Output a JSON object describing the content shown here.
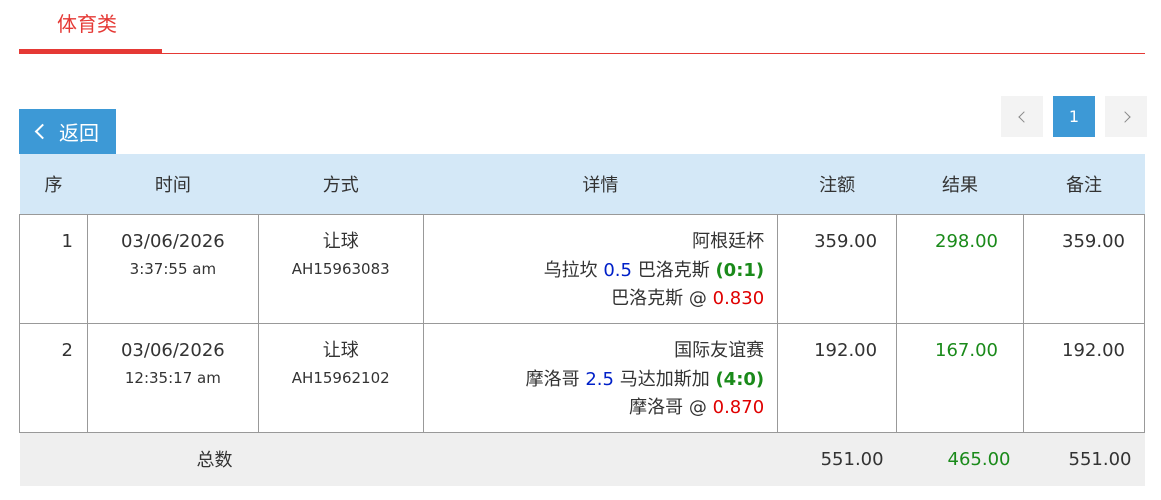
{
  "tabs": {
    "active_label": "体育类"
  },
  "back_button": {
    "label": "返回"
  },
  "pagination": {
    "current_page": "1"
  },
  "table": {
    "headers": {
      "no": "序",
      "time": "时间",
      "method": "方式",
      "detail": "详情",
      "stake": "注额",
      "result": "结果",
      "note": "备注"
    },
    "rows": [
      {
        "no": "1",
        "date": "03/06/2026",
        "time": "3:37:55 am",
        "method": "让球",
        "code": "AH15963083",
        "league": "阿根廷杯",
        "home": "乌拉坎",
        "handicap": "0.5",
        "away": "巴洛克斯",
        "score": "(0:1)",
        "pick": "巴洛克斯",
        "at": "@",
        "odds": "0.830",
        "stake": "359.00",
        "result": "298.00",
        "note": "359.00"
      },
      {
        "no": "2",
        "date": "03/06/2026",
        "time": "12:35:17 am",
        "method": "让球",
        "code": "AH15962102",
        "league": "国际友谊赛",
        "home": "摩洛哥",
        "handicap": "2.5",
        "away": "马达加斯加",
        "score": "(4:0)",
        "pick": "摩洛哥",
        "at": "@",
        "odds": "0.870",
        "stake": "192.00",
        "result": "167.00",
        "note": "192.00"
      }
    ],
    "totals": {
      "label": "总数",
      "stake": "551.00",
      "result": "465.00",
      "note": "551.00"
    }
  },
  "colors": {
    "accent_red": "#e53935",
    "button_blue": "#3d99d6",
    "header_bg": "#d4e8f7",
    "win_green": "#1a8a1a",
    "handicap_blue": "#0020c8",
    "odds_red": "#e00000"
  },
  "icons": {
    "back": "chevron-left-icon",
    "prev": "chevron-left-icon",
    "next": "chevron-right-icon"
  }
}
